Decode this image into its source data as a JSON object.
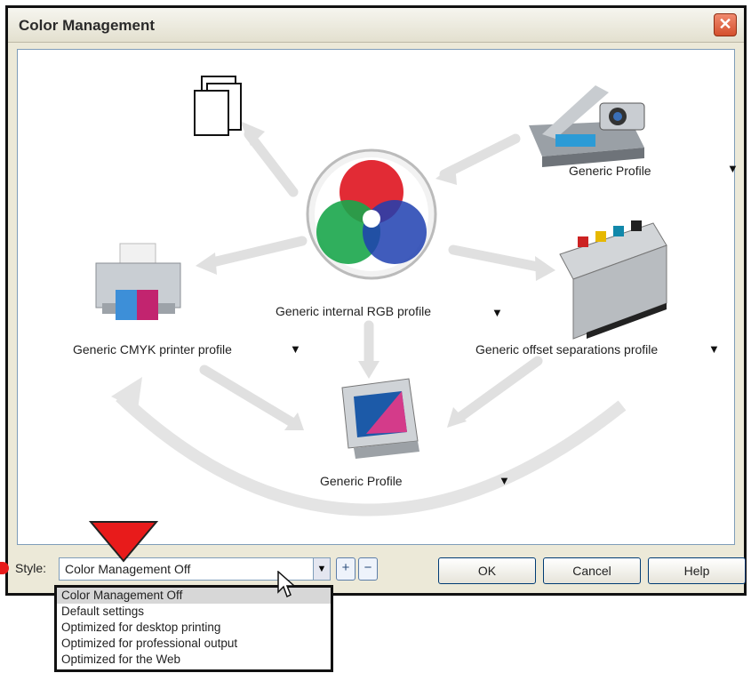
{
  "window": {
    "title": "Color Management"
  },
  "diagram": {
    "internal_rgb": {
      "label": "Generic internal RGB profile"
    },
    "scanner": {
      "label": "Generic Profile"
    },
    "printer": {
      "label": "Generic CMYK printer profile"
    },
    "offset_press": {
      "label": "Generic offset separations profile"
    },
    "monitor": {
      "label": "Generic Profile"
    }
  },
  "style": {
    "label": "Style:",
    "selected": "Color Management Off",
    "options": [
      "Color Management Off",
      "Default settings",
      "Optimized for desktop printing",
      "Optimized for professional output",
      "Optimized for the Web"
    ]
  },
  "buttons": {
    "ok": "OK",
    "cancel": "Cancel",
    "help": "Help"
  },
  "icons": {
    "add": "plus-icon",
    "remove": "minus-icon",
    "dropdown": "chevron-down-icon",
    "close": "close-icon"
  },
  "colors": {
    "accent_red": "#e81b1b",
    "title_close": "#d4502e"
  }
}
